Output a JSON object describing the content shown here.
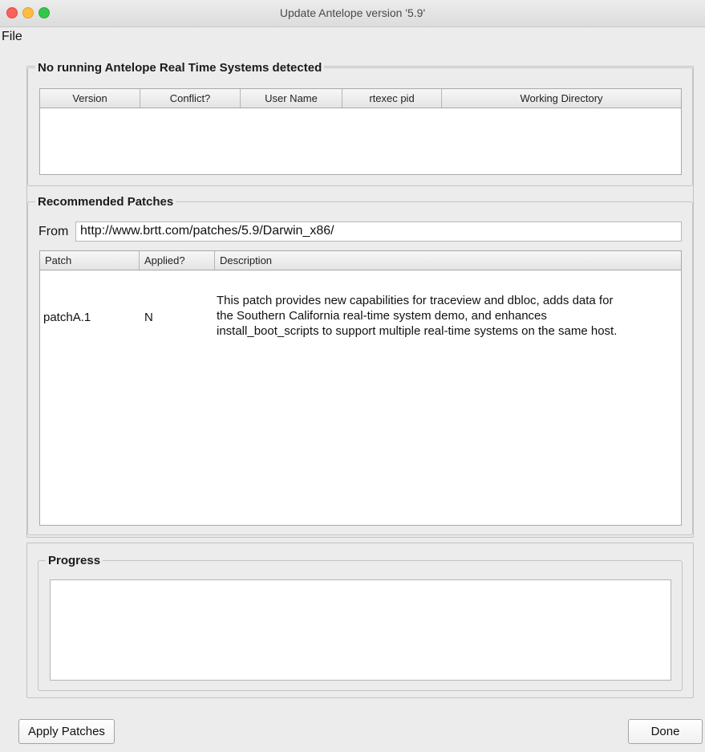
{
  "window": {
    "title": "Update Antelope version '5.9'"
  },
  "menu": {
    "file": "File"
  },
  "rts": {
    "legend": "No running Antelope Real Time Systems detected",
    "columns": [
      "Version",
      "Conflict?",
      "User Name",
      "rtexec pid",
      "Working Directory"
    ]
  },
  "patches": {
    "legend": "Recommended Patches",
    "from_label": "From",
    "from_url": "http://www.brtt.com/patches/5.9/Darwin_x86/",
    "columns": [
      "Patch",
      "Applied?",
      "Description"
    ],
    "rows": [
      {
        "patch": "patchA.1",
        "applied": "N",
        "description": [
          "This patch provides new capabilities for traceview and dbloc, adds data for",
          "the Southern California real-time system demo, and enhances",
          "install_boot_scripts to support multiple real-time systems on the same host."
        ]
      }
    ]
  },
  "progress": {
    "legend": "Progress"
  },
  "buttons": {
    "apply": "Apply Patches",
    "done": "Done"
  },
  "colors": {
    "close": "#fc605b",
    "minimize": "#fdbc40",
    "maximize": "#34c84a",
    "outside": "#fffbe0"
  }
}
